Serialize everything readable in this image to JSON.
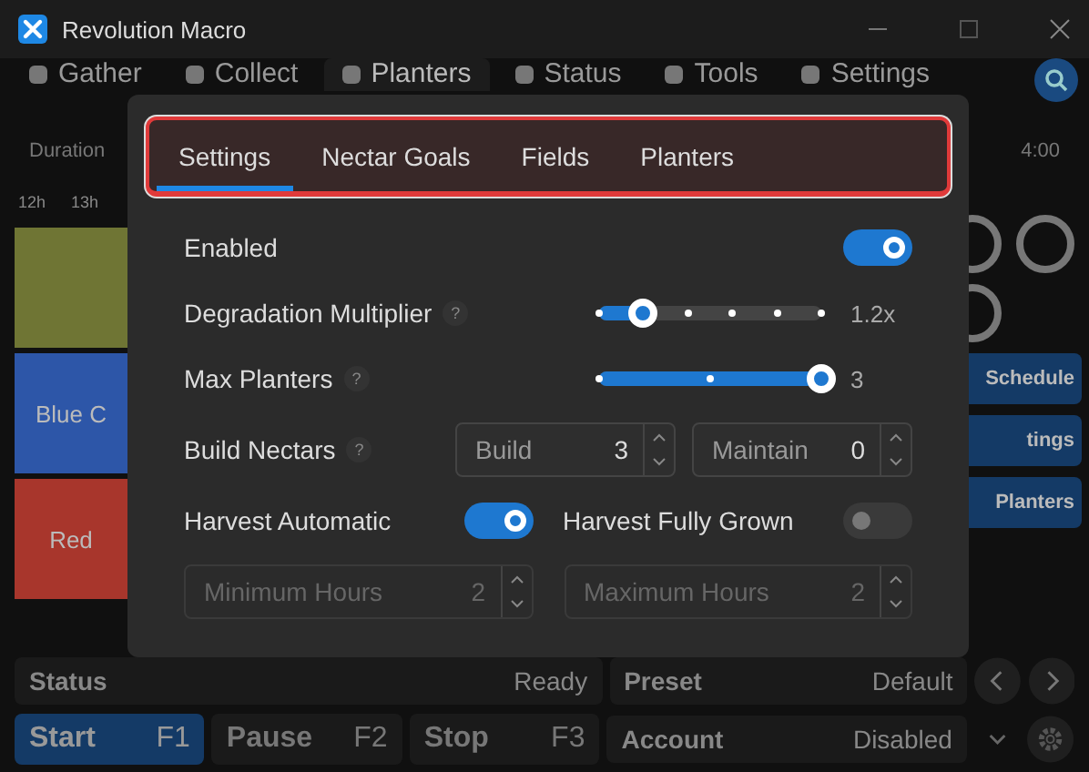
{
  "window": {
    "title": "Revolution Macro"
  },
  "nav_tabs": [
    {
      "label": "Gather",
      "selected": false
    },
    {
      "label": "Collect",
      "selected": false
    },
    {
      "label": "Planters",
      "selected": true
    },
    {
      "label": "Status",
      "selected": false
    },
    {
      "label": "Tools",
      "selected": false
    },
    {
      "label": "Settings",
      "selected": false
    }
  ],
  "toolbar": {
    "duration_label": "Duration",
    "time": "4:00"
  },
  "timeline": {
    "hours": [
      "12h",
      "13h"
    ],
    "rows": [
      {
        "label": "",
        "color": "#6f7534"
      },
      {
        "label": "Blue C",
        "color": "#2d56a8"
      },
      {
        "label": "Red",
        "color": "#a8362c"
      }
    ]
  },
  "side_buttons": [
    "Schedule",
    "tings",
    "Planters"
  ],
  "status": {
    "label": "Status",
    "value": "Ready"
  },
  "preset": {
    "label": "Preset",
    "value": "Default"
  },
  "controls": [
    {
      "label": "Start",
      "key": "F1",
      "selected": true
    },
    {
      "label": "Pause",
      "key": "F2",
      "selected": false
    },
    {
      "label": "Stop",
      "key": "F3",
      "selected": false
    }
  ],
  "account": {
    "label": "Account",
    "value": "Disabled"
  },
  "dialog": {
    "tabs": [
      {
        "label": "Settings",
        "selected": true
      },
      {
        "label": "Nectar Goals",
        "selected": false
      },
      {
        "label": "Fields",
        "selected": false
      },
      {
        "label": "Planters",
        "selected": false
      }
    ],
    "settings": [
      {
        "kind": "toggle",
        "label": "Enabled",
        "on": true
      },
      {
        "kind": "slider",
        "label": "Degradation Multiplier",
        "help": "?",
        "level": 0.2,
        "reading": "1.2x"
      },
      {
        "kind": "slider",
        "label": "Max Planters",
        "help": "?",
        "level": 1,
        "reading": "3"
      },
      {
        "kind": "spinners",
        "label": "Build Nectars",
        "help": "?",
        "disabled": false,
        "fields": [
          {
            "label": "Build",
            "value": "3"
          },
          {
            "label": "Maintain",
            "value": "0"
          }
        ]
      },
      {
        "kind": "toggles",
        "items": [
          {
            "label": "Harvest Automatic",
            "on": true
          },
          {
            "label": "Harvest Fully Grown",
            "on": false
          }
        ]
      },
      {
        "kind": "spinners",
        "disabled": true,
        "fields": [
          {
            "label": "Minimum Hours",
            "value": "2"
          },
          {
            "label": "Maximum Hours",
            "value": "2"
          }
        ]
      }
    ]
  }
}
